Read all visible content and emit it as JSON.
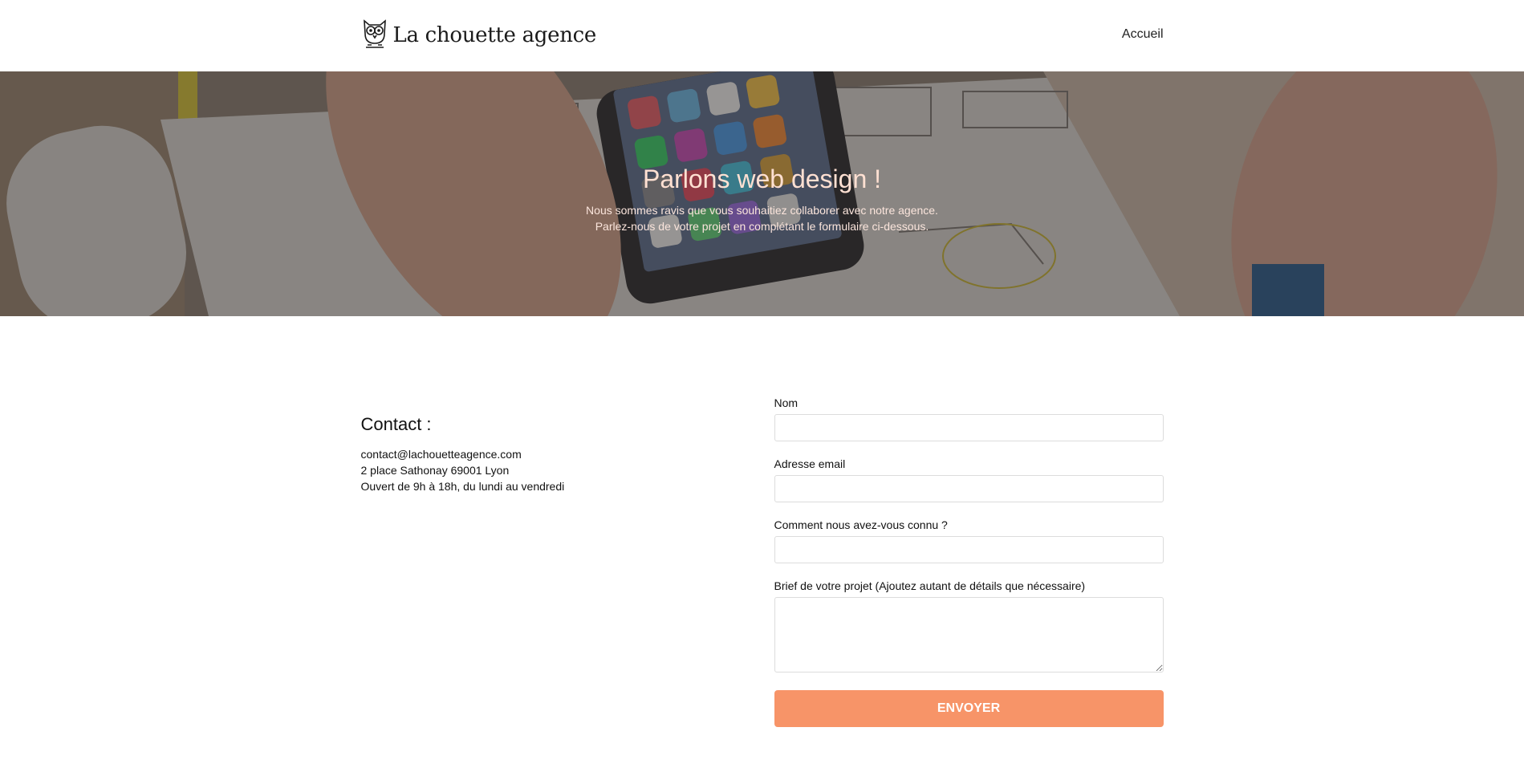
{
  "header": {
    "logo_text": "La chouette agence",
    "logo_icon": "owl-icon",
    "nav": [
      {
        "label": "Accueil"
      }
    ]
  },
  "hero": {
    "title": "Parlons web design !",
    "subtitle_line1": "Nous sommes ravis que vous souhaitiez collaborer avec notre agence.",
    "subtitle_line2": "Parlez-nous de votre projet en complétant le formulaire ci-dessous."
  },
  "contact": {
    "title": "Contact :",
    "email": "contact@lachouetteagence.com",
    "address": "2 place Sathonay 69001 Lyon",
    "hours": "Ouvert de 9h à 18h, du lundi au vendredi"
  },
  "form": {
    "name_label": "Nom",
    "name_value": "",
    "email_label": "Adresse email",
    "email_value": "",
    "source_label": "Comment nous avez-vous connu ?",
    "source_value": "",
    "brief_label": "Brief de votre projet (Ajoutez autant de détails que nécessaire)",
    "brief_value": "",
    "submit_label": "ENVOYER"
  },
  "colors": {
    "accent": "#f79468",
    "hero_text": "#ffe0d2",
    "field_border": "#dcdcdc"
  }
}
